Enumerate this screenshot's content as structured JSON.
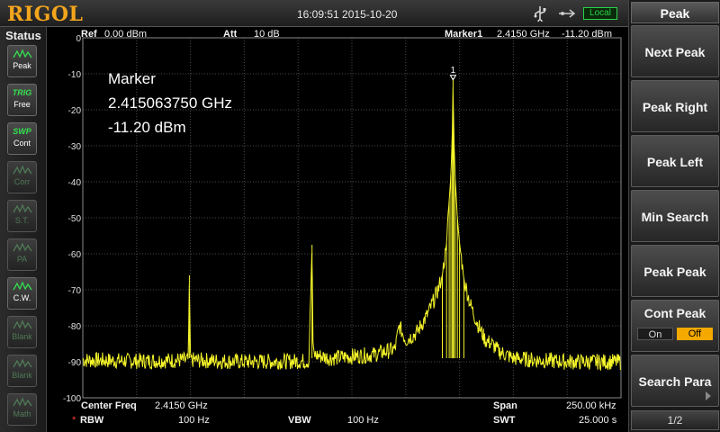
{
  "topbar": {
    "logo": "RIGOL",
    "datetime": "16:09:51 2015-10-20",
    "icons": [
      "usb-icon",
      "network-icon"
    ],
    "local_badge": "Local"
  },
  "status": {
    "title": "Status",
    "buttons": [
      {
        "top": "",
        "bottom": "Peak",
        "icon": "peak-wave-icon",
        "active": true
      },
      {
        "top": "TRIG",
        "bottom": "Free",
        "icon": "",
        "active": true
      },
      {
        "top": "SWP",
        "bottom": "Cont",
        "icon": "",
        "active": true
      },
      {
        "top": "",
        "bottom": "Corr",
        "icon": "corr-wave-icon",
        "active": false
      },
      {
        "top": "",
        "bottom": "S.T.",
        "icon": "st-wave-icon",
        "active": false
      },
      {
        "top": "",
        "bottom": "PA",
        "icon": "pa-icon",
        "active": false
      },
      {
        "top": "",
        "bottom": "C.W.",
        "icon": "cw-wave-icon",
        "active": true
      },
      {
        "top": "",
        "bottom": "Blank",
        "icon": "blank-wave-icon",
        "active": false
      },
      {
        "top": "",
        "bottom": "Blank",
        "icon": "blank-wave-icon",
        "active": false
      },
      {
        "top": "",
        "bottom": "Math",
        "icon": "math-wave-icon",
        "active": false
      }
    ]
  },
  "header": {
    "ref_label": "Ref",
    "ref_value": "0.00 dBm",
    "att_label": "Att",
    "att_value": "10 dB",
    "marker_label": "Marker1",
    "marker_freq": "2.4150 GHz",
    "marker_level": "-11.20 dBm"
  },
  "marker_box": {
    "title": "Marker",
    "freq": "2.415063750 GHz",
    "level": "-11.20 dBm",
    "marker_number": "1"
  },
  "footer": {
    "center_label": "Center Freq",
    "center_value": "2.4150 GHz",
    "span_label": "Span",
    "span_value": "250.00 kHz",
    "rbw_star": "*",
    "rbw_label": "RBW",
    "rbw_value": "100 Hz",
    "vbw_label": "VBW",
    "vbw_value": "100 Hz",
    "swt_label": "SWT",
    "swt_value": "25.000 s"
  },
  "menu": {
    "title": "Peak",
    "buttons": [
      "Next Peak",
      "Peak Right",
      "Peak Left",
      "Min Search",
      "Peak Peak"
    ],
    "cont_peak": {
      "label": "Cont Peak",
      "on": "On",
      "off": "Off"
    },
    "search_para": "Search Para",
    "page": "1/2"
  },
  "chart_data": {
    "type": "line",
    "title": "",
    "xlabel": "",
    "ylabel": "",
    "y_ticks": [
      "0",
      "-10",
      "-20",
      "-30",
      "-40",
      "-50",
      "-60",
      "-70",
      "-80",
      "-90",
      "-100"
    ],
    "ylim": [
      -100,
      0
    ],
    "xlim_khz": [
      -125,
      125
    ],
    "grid": true,
    "trace_color": "#f5f52a",
    "noise_floor_dbm": -89.5,
    "series": [
      {
        "points_khz_dbm": [
          [
            -125,
            -89.5
          ],
          [
            -100,
            -89.8
          ],
          [
            -76,
            -89.5
          ],
          [
            -75.5,
            -66
          ],
          [
            -75,
            -89.5
          ],
          [
            -50,
            -90
          ],
          [
            -20,
            -89.8
          ],
          [
            -18.5,
            -57.5
          ],
          [
            -18,
            -88
          ],
          [
            -10,
            -89
          ],
          [
            10,
            -88
          ],
          [
            20,
            -86.5
          ],
          [
            22,
            -80
          ],
          [
            25,
            -84
          ],
          [
            30,
            -82
          ],
          [
            32,
            -80
          ],
          [
            35,
            -77
          ],
          [
            38,
            -73
          ],
          [
            40,
            -70
          ],
          [
            42,
            -66
          ],
          [
            44,
            -57
          ],
          [
            45.2,
            -45
          ],
          [
            46,
            -38
          ],
          [
            46.7,
            -25
          ],
          [
            47,
            -11.2
          ],
          [
            47.3,
            -26
          ],
          [
            48,
            -39
          ],
          [
            49,
            -50
          ],
          [
            50,
            -57
          ],
          [
            52,
            -67
          ],
          [
            55,
            -74
          ],
          [
            58,
            -79
          ],
          [
            62,
            -84
          ],
          [
            65,
            -85
          ],
          [
            68,
            -87
          ],
          [
            75,
            -89
          ],
          [
            85,
            -89.5
          ],
          [
            100,
            -90
          ],
          [
            125,
            -90
          ]
        ]
      }
    ]
  }
}
